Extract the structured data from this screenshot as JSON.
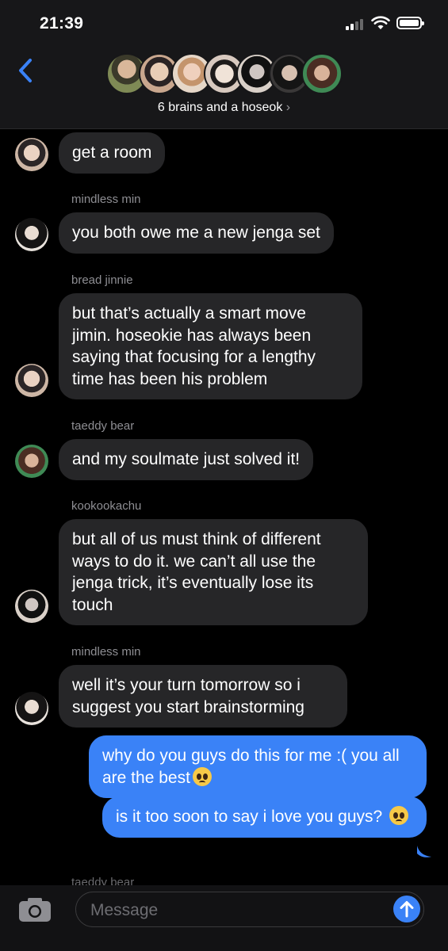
{
  "status": {
    "time": "21:39"
  },
  "header": {
    "title": "6 brains and a hoseok",
    "chevron": "›"
  },
  "messages": [
    {
      "sender": "",
      "text": "get a room",
      "direction": "in"
    },
    {
      "sender": "mindless min",
      "text": "you both owe me a new jenga set",
      "direction": "in"
    },
    {
      "sender": "bread jinnie",
      "text": "but that’s actually a smart move jimin. hoseokie has always been saying that focusing for a lengthy time has been his problem",
      "direction": "in"
    },
    {
      "sender": "taeddy bear",
      "text": "and my soulmate just solved it!",
      "direction": "in"
    },
    {
      "sender": "kookookachu",
      "text": "but all of us must think of different ways to do it. we can’t all use the jenga trick, it’s eventually lose its touch",
      "direction": "in"
    },
    {
      "sender": "mindless min",
      "text": "well it’s your turn tomorrow so i suggest you start brainstorming",
      "direction": "in"
    },
    {
      "sender": "",
      "text": "why do you guys do this for me :( you all are the best",
      "direction": "out"
    },
    {
      "sender": "",
      "text": "is it too soon to say i love you guys?",
      "direction": "out"
    }
  ],
  "partial_sender": "taeddy bear",
  "compose": {
    "placeholder": "Message"
  },
  "colors": {
    "outgoing": "#3a82f7",
    "incoming": "#262628",
    "background": "#000000"
  }
}
